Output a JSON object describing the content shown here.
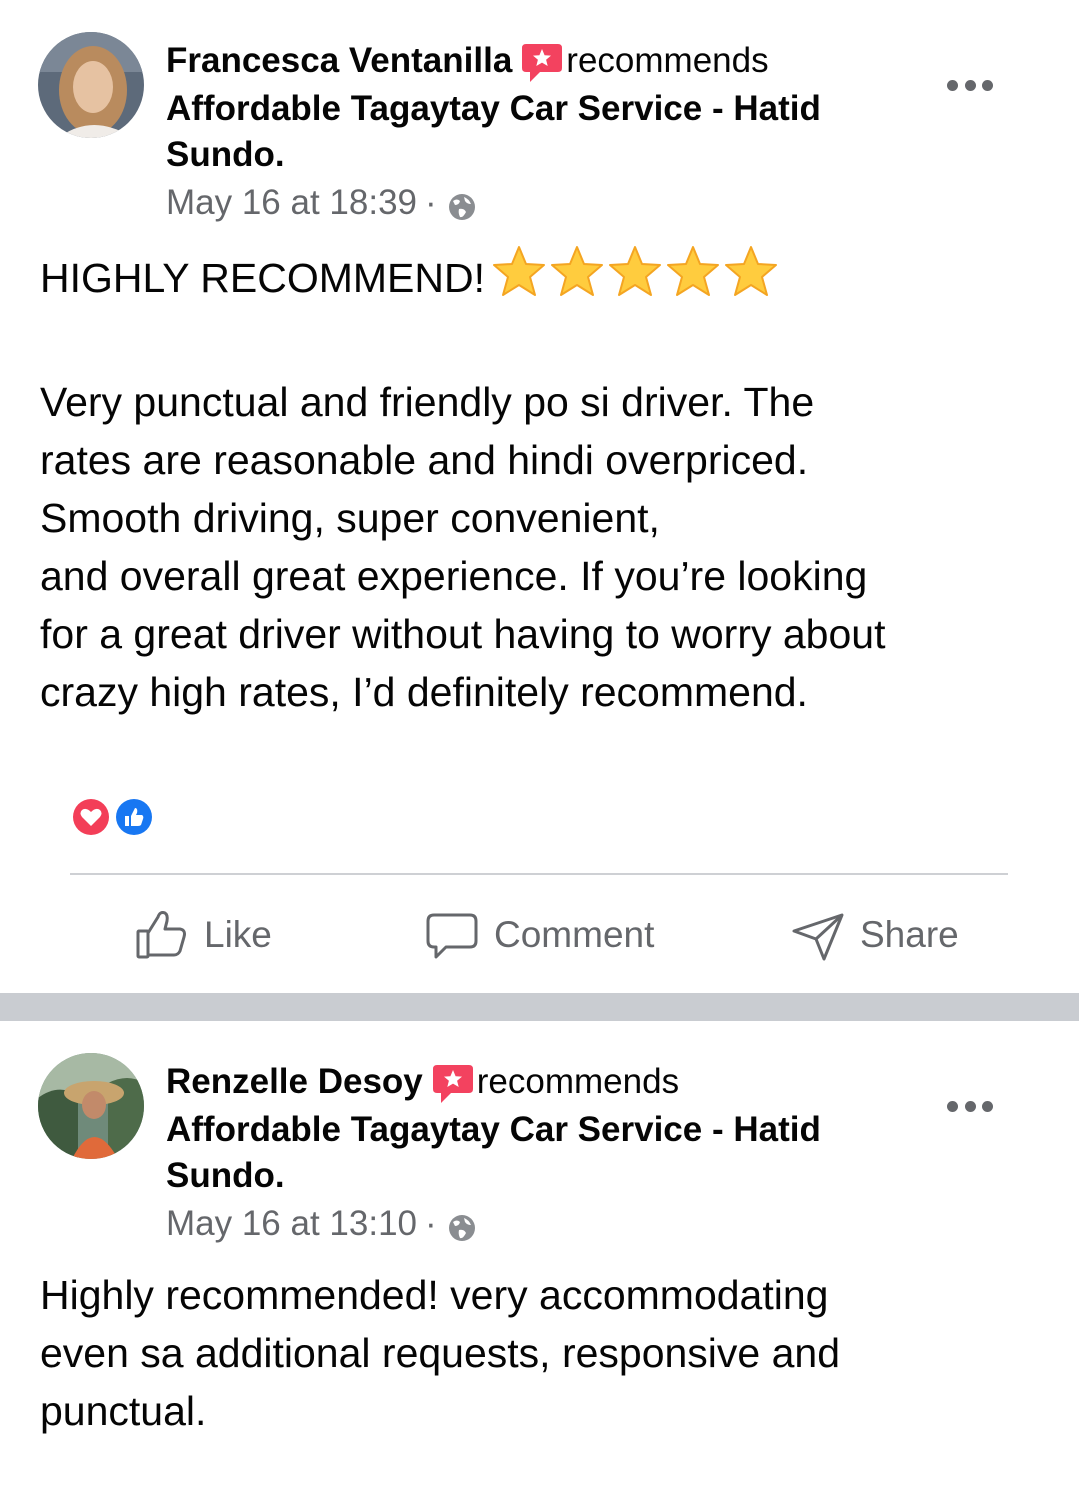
{
  "posts": [
    {
      "author": "Francesca Ventanilla",
      "recommends_label": "recommends",
      "page_line1": "Affordable Tagaytay Car Service - Hatid",
      "page_line2": "Sundo.",
      "timestamp": "May 16 at 18:39",
      "separator": "·",
      "privacy_icon": "globe-icon",
      "body_lines": [
        "HIGHLY RECOMMEND!",
        "",
        "Very punctual and friendly po si driver. The",
        "rates are reasonable and hindi overpriced.",
        "Smooth driving, super convenient,",
        "and overall great experience. If you’re looking",
        "for a great driver without having to worry about",
        "crazy high rates, I’d definitely recommend."
      ],
      "rating_stars": 5,
      "reactions": [
        "love-reaction-icon",
        "like-reaction-icon"
      ]
    },
    {
      "author": "Renzelle Desoy",
      "recommends_label": "recommends",
      "page_line1": "Affordable Tagaytay Car Service - Hatid",
      "page_line2": "Sundo.",
      "timestamp": "May 16 at 13:10",
      "separator": "·",
      "privacy_icon": "globe-icon",
      "body_lines": [
        "Highly recommended! very accommodating",
        "even sa additional requests, responsive and",
        "punctual."
      ]
    }
  ],
  "actions": {
    "like": "Like",
    "comment": "Comment",
    "share": "Share"
  },
  "colors": {
    "secondary_text": "#65676b",
    "recommend_badge": "#f3425f",
    "like_blue": "#1877f2",
    "divider": "#c9ccd1"
  }
}
